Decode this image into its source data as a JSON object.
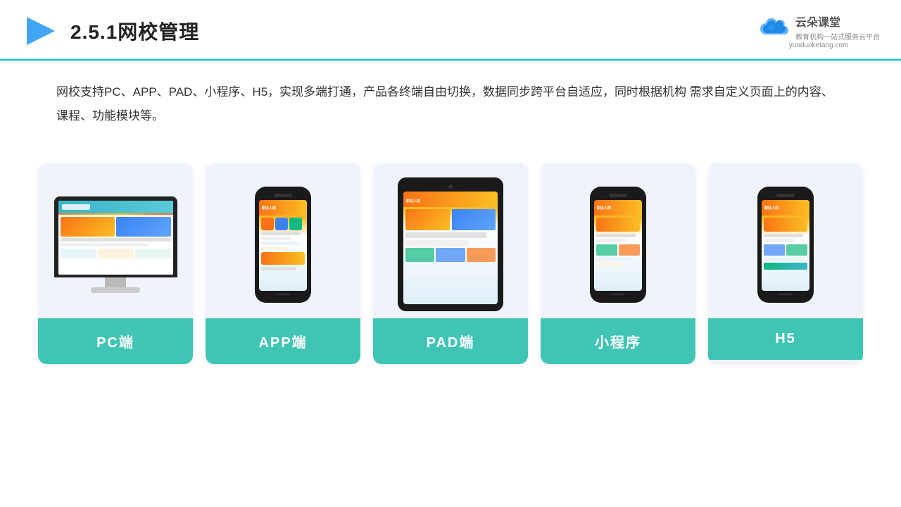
{
  "header": {
    "title": "2.5.1网校管理",
    "brand_name": "云朵课堂",
    "brand_tagline": "教育机构一站\n式服务云平台",
    "brand_url": "yunduoketang.com"
  },
  "description": {
    "text": "网校支持PC、APP、PAD、小程序、H5，实现多端打通，产品各终端自由切换，数据同步跨平台自适应，同时根据机构\n需求自定义页面上的内容、课程、功能模块等。"
  },
  "cards": [
    {
      "label": "PC端",
      "type": "pc"
    },
    {
      "label": "APP端",
      "type": "phone"
    },
    {
      "label": "PAD端",
      "type": "tablet"
    },
    {
      "label": "小程序",
      "type": "phone2"
    },
    {
      "label": "H5",
      "type": "phone3"
    }
  ],
  "accent_color": "#40c5b5"
}
